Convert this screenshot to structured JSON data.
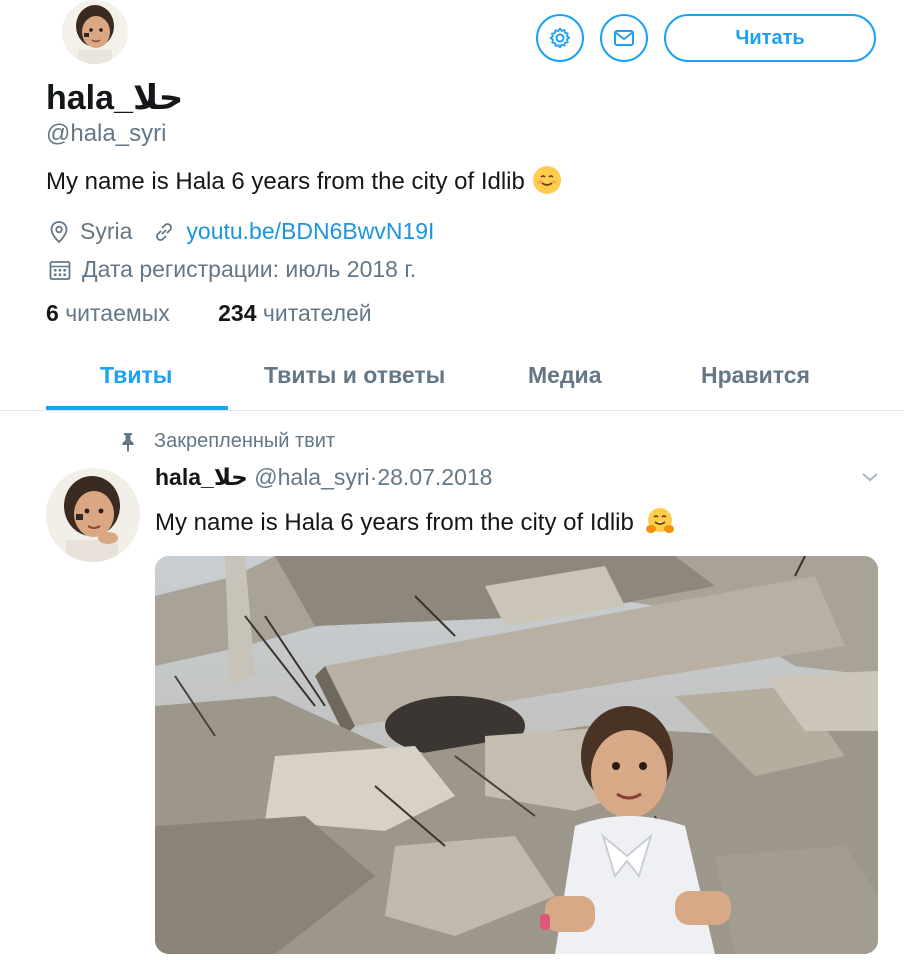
{
  "profile": {
    "name": "hala_حلا",
    "handle": "@hala_syri",
    "bio": "My name is Hala 6 years from the city of Idlib",
    "bio_emoji": "smiling-face-emoji",
    "location": "Syria",
    "website": "youtu.be/BDN6BwvN19I",
    "joined": "Дата регистрации: июль 2018 г.",
    "following_count": "6",
    "following_label": "читаемых",
    "followers_count": "234",
    "followers_label": "читателей"
  },
  "header": {
    "follow_label": "Читать",
    "settings_icon": "gear-icon",
    "message_icon": "envelope-icon"
  },
  "tabs": [
    {
      "label": "Твиты",
      "active": true
    },
    {
      "label": "Твиты и ответы",
      "active": false
    },
    {
      "label": "Медиа",
      "active": false
    },
    {
      "label": "Нравится",
      "active": false
    }
  ],
  "pinned_tweet": {
    "pinned_label": "Закрепленный твит",
    "author_name": "hala_حلا",
    "author_handle": "@hala_syri",
    "separator": "·",
    "date": "28.07.2018",
    "text": "My name is Hala 6 years from the city of Idlib",
    "text_emoji": "hugging-face-emoji",
    "media": "rubble-photo-with-girl"
  },
  "colors": {
    "accent": "#1da1f2",
    "link": "#1b95e0",
    "secondary_text": "#657786",
    "primary_text": "#14171a",
    "divider": "#e1e8ed"
  }
}
